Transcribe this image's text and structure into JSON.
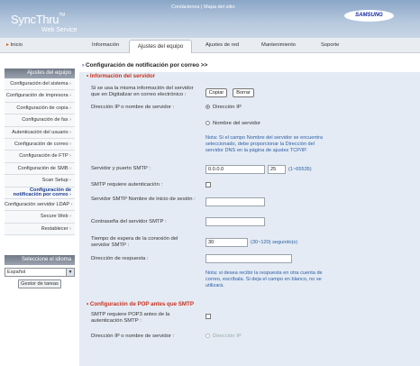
{
  "header": {
    "logo": "SyncThru",
    "logo_tm": "TM",
    "logo_sub": "Web Service",
    "top_links": "Contáctenos  |  Mapa del sitio",
    "brand": "SAMSUNG",
    "brand_sub": "ELECTRONICS"
  },
  "nav": {
    "home": "Inicio",
    "tabs": [
      {
        "label": "Información"
      },
      {
        "label": "Ajustes del equipo"
      },
      {
        "label": "Ajustes de red"
      },
      {
        "label": "Mantenimiento"
      },
      {
        "label": "Soporte"
      }
    ]
  },
  "sidebar": {
    "header": "Ajustes del equipo",
    "items": [
      {
        "label": "Configuración del sistema"
      },
      {
        "label": "Configuración de impresora"
      },
      {
        "label": "Configuración de copia"
      },
      {
        "label": "Configuración de fax"
      },
      {
        "label": "Autenticación del usuario"
      },
      {
        "label": "Configuración de correo"
      },
      {
        "label": "Configuración de FTP"
      },
      {
        "label": "Configuración de SMB"
      },
      {
        "label": "Scan Setup"
      },
      {
        "label": "Configuración de notificación por correo"
      },
      {
        "label": "Configuración servidor LDAP"
      },
      {
        "label": "Secure Web"
      },
      {
        "label": "Restablecer"
      }
    ],
    "language_header": "Seleccione el idioma",
    "language_value": "Español",
    "task_button": "Gestor de tareas"
  },
  "main": {
    "title": "Configuración de notificación por correo >>",
    "server_section": "Información del servidor",
    "same_info_label": "Si se usa la misma información del servidor que en Digitalizar en correo electrónico :",
    "copy_button": "Copiar",
    "delete_button": "Borrar",
    "server_addr_label": "Dirección IP o nombre de servidor :",
    "radio_ip": "Dirección IP",
    "radio_name": "Nombre del servidor",
    "dns_note": "Nota: Si el campo Nombre del servidor se encuentra seleccionado, debe proporcionar la Dirección del servidor DNS en la página de ajustes TCP/IP.",
    "smtp_server_label": "Servidor y puerto SMTP :",
    "smtp_server_value": "0.0.0.0",
    "smtp_port_value": "25",
    "smtp_port_hint": "(1~65535)",
    "smtp_auth_label": "SMTP requiere autenticación :",
    "smtp_login_label": "Servidor SMTP Nombre de inicio de sesión :",
    "smtp_password_label": "Contraseña del servidor SMTP :",
    "timeout_label": "Tiempo de espera de la conexión del servidor SMTP :",
    "timeout_value": "30",
    "timeout_hint": "(30~120) segundo(s)",
    "reply_label": "Dirección de respuesta :",
    "reply_note": "Nota: si desea recibir la respuesta en otra cuenta de correo, escríbala. Si deja el campo en blanco, no se utilizará.",
    "pop_section": "Configuración de POP antes que SMTP",
    "pop_required_label": "SMTP requiere POP3 antes de la autenticación SMTP :",
    "pop_addr_label": "Dirección IP o nombre de servidor :",
    "pop_radio_ip": "Dirección IP"
  }
}
